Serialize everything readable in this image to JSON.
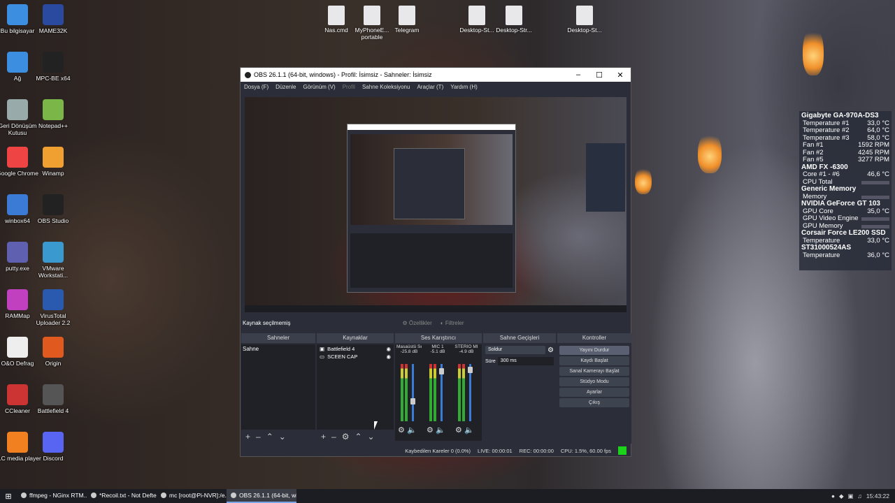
{
  "desktop": {
    "icons_left": [
      {
        "label": "Bu bilgisayar",
        "icon": "computer-icon",
        "color": "#3b8ee0"
      },
      {
        "label": "MAME32K",
        "icon": "mame-icon",
        "color": "#2a4aa0"
      },
      {
        "label": "Ağ",
        "icon": "network-icon",
        "color": "#3b8ee0"
      },
      {
        "label": "MPC-BE x64",
        "icon": "film-icon",
        "color": "#222"
      },
      {
        "label": "Geri Dönüşüm Kutusu",
        "icon": "recycle-bin-icon",
        "color": "#9aa"
      },
      {
        "label": "Notepad++",
        "icon": "notepadpp-icon",
        "color": "#7ab648"
      },
      {
        "label": "Google Chrome",
        "icon": "chrome-icon",
        "color": "#e44"
      },
      {
        "label": "Winamp",
        "icon": "winamp-icon",
        "color": "#f0a030"
      },
      {
        "label": "winbox64",
        "icon": "winbox-icon",
        "color": "#3b7bd5"
      },
      {
        "label": "OBS Studio",
        "icon": "obs-icon",
        "color": "#222"
      },
      {
        "label": "putty.exe",
        "icon": "putty-icon",
        "color": "#6060b0"
      },
      {
        "label": "VMware Workstati...",
        "icon": "vmware-icon",
        "color": "#3a9ad0"
      },
      {
        "label": "RAMMap",
        "icon": "rammap-icon",
        "color": "#c040c0"
      },
      {
        "label": "VirusTotal Uploader 2.2",
        "icon": "virustotal-icon",
        "color": "#2a5ab0"
      },
      {
        "label": "O&O Defrag",
        "icon": "document-icon",
        "color": "#eee"
      },
      {
        "label": "Origin",
        "icon": "origin-icon",
        "color": "#e05a20"
      },
      {
        "label": "CCleaner",
        "icon": "ccleaner-icon",
        "color": "#c33"
      },
      {
        "label": "Battlefield 4",
        "icon": "battlefield-icon",
        "color": "#555"
      },
      {
        "label": "VLC media player",
        "icon": "vlc-icon",
        "color": "#f08020"
      },
      {
        "label": "Discord",
        "icon": "discord-icon",
        "color": "#5865f2"
      }
    ],
    "icons_top": [
      {
        "label": "Nas.cmd"
      },
      {
        "label": "MyPhoneE... portable"
      },
      {
        "label": "Telegram"
      },
      {
        "label": "Desktop-St..."
      },
      {
        "label": "Desktop-Str..."
      },
      {
        "label": "Desktop-St..."
      }
    ]
  },
  "hwmonitor": {
    "sections": [
      {
        "title": "Gigabyte GA-970A-DS3",
        "rows": [
          [
            "Temperature #1",
            "33,0 °C"
          ],
          [
            "Temperature #2",
            "64,0 °C"
          ],
          [
            "Temperature #3",
            "58,0 °C"
          ],
          [
            "Fan #1",
            "1592 RPM"
          ],
          [
            "Fan #2",
            "4245 RPM"
          ],
          [
            "Fan #5",
            "3277 RPM"
          ]
        ]
      },
      {
        "title": "AMD FX -6300",
        "rows": [
          [
            "Core #1 - #6",
            "46,6 °C"
          ],
          [
            "CPU Total",
            ""
          ]
        ]
      },
      {
        "title": "Generic Memory",
        "rows": [
          [
            "Memory",
            ""
          ]
        ]
      },
      {
        "title": "NVIDIA GeForce GT 103",
        "rows": [
          [
            "GPU Core",
            "35,0 °C"
          ],
          [
            "GPU Video Engine",
            ""
          ],
          [
            "GPU Memory",
            ""
          ]
        ]
      },
      {
        "title": "Corsair Force LE200 SSD",
        "rows": [
          [
            "Temperature",
            "33,0 °C"
          ]
        ]
      },
      {
        "title": "ST31000524AS",
        "rows": [
          [
            "Temperature",
            "36,0 °C"
          ]
        ]
      }
    ]
  },
  "obs": {
    "title": "OBS 26.1.1 (64-bit, windows) - Profil: İsimsiz - Sahneler: İsimsiz",
    "menu": [
      "Dosya (F)",
      "Düzenle",
      "Görünüm (V)",
      "Profil",
      "Sahne Koleksiyonu",
      "Araçlar (T)",
      "Yardım (H)"
    ],
    "source_strip": {
      "label": "Kaynak seçilmemiş",
      "properties": "Özellikler",
      "filters": "Filtreler"
    },
    "docks": {
      "scenes": {
        "title": "Sahneler",
        "items": [
          "Sahne"
        ]
      },
      "sources": {
        "title": "Kaynaklar",
        "items": [
          "Battlefield 4",
          "SCEEN CAP"
        ]
      },
      "mixer": {
        "title": "Ses Karıştırıcı",
        "channels": [
          {
            "name": "Masaüstü Ses",
            "db": "-25.8 dB",
            "level": 0.35
          },
          {
            "name": "MIC 1",
            "db": "-5.1 dB",
            "level": 0.88
          },
          {
            "name": "STERIO MI",
            "db": "-4.9 dB",
            "level": 0.9
          }
        ]
      },
      "transitions": {
        "title": "Sahne Geçişleri",
        "type": "Soldur",
        "duration_label": "Süre",
        "duration": "300 ms"
      },
      "controls": {
        "title": "Kontroller",
        "buttons": [
          "Yayını Durdur",
          "Kaydı Başlat",
          "Sanal Kamerayı Başlat",
          "Stüdyo Modu",
          "Ayarlar",
          "Çıkış"
        ]
      }
    },
    "status": {
      "dropped": "Kaybedilen Kareler 0 (0.0%)",
      "live": "LIVE: 00:00:01",
      "rec": "REC: 00:00:00",
      "cpu": "CPU: 1.5%, 60.00 fps"
    }
  },
  "taskbar": {
    "items": [
      {
        "label": "ffmpeg - NGinx RTM...",
        "icon": "chrome-icon"
      },
      {
        "label": "*Recoil.txt - Not Defteri",
        "icon": "notepad-icon"
      },
      {
        "label": "mc [root@Pi-NVR]:/e...",
        "icon": "terminal-icon"
      },
      {
        "label": "OBS 26.1.1 (64-bit, wi...",
        "icon": "obs-icon"
      }
    ],
    "time": "15:43:22"
  }
}
